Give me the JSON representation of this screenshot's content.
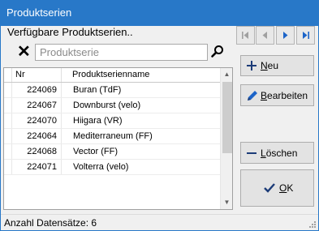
{
  "window": {
    "title": "Produktserien"
  },
  "group": {
    "label": "Verfügbare Produktserien.."
  },
  "search": {
    "placeholder": "Produktserie",
    "value": "",
    "clear_label": "✕"
  },
  "table": {
    "columns": [
      {
        "label": "Nr"
      },
      {
        "label": "Produktserienname"
      }
    ],
    "rows": [
      {
        "nr": "224069",
        "name": "Buran (TdF)"
      },
      {
        "nr": "224067",
        "name": "Downburst (velo)"
      },
      {
        "nr": "224070",
        "name": "Hiigara (VR)"
      },
      {
        "nr": "224064",
        "name": "Mediterraneum (FF)"
      },
      {
        "nr": "224068",
        "name": "Vector (FF)"
      },
      {
        "nr": "224071",
        "name": "Volterra (velo)"
      }
    ]
  },
  "nav": {
    "icons": [
      "first-icon",
      "prev-icon",
      "next-icon",
      "last-icon"
    ]
  },
  "buttons": {
    "new": "Neu",
    "edit": "Bearbeiten",
    "delete": "Löschen",
    "ok": "OK"
  },
  "status": {
    "text": "Anzahl Datensätze: 6"
  },
  "colors": {
    "titlebar": "#2878c8",
    "accent_blue": "#1c64c8",
    "disabled": "#a0a0a0"
  }
}
